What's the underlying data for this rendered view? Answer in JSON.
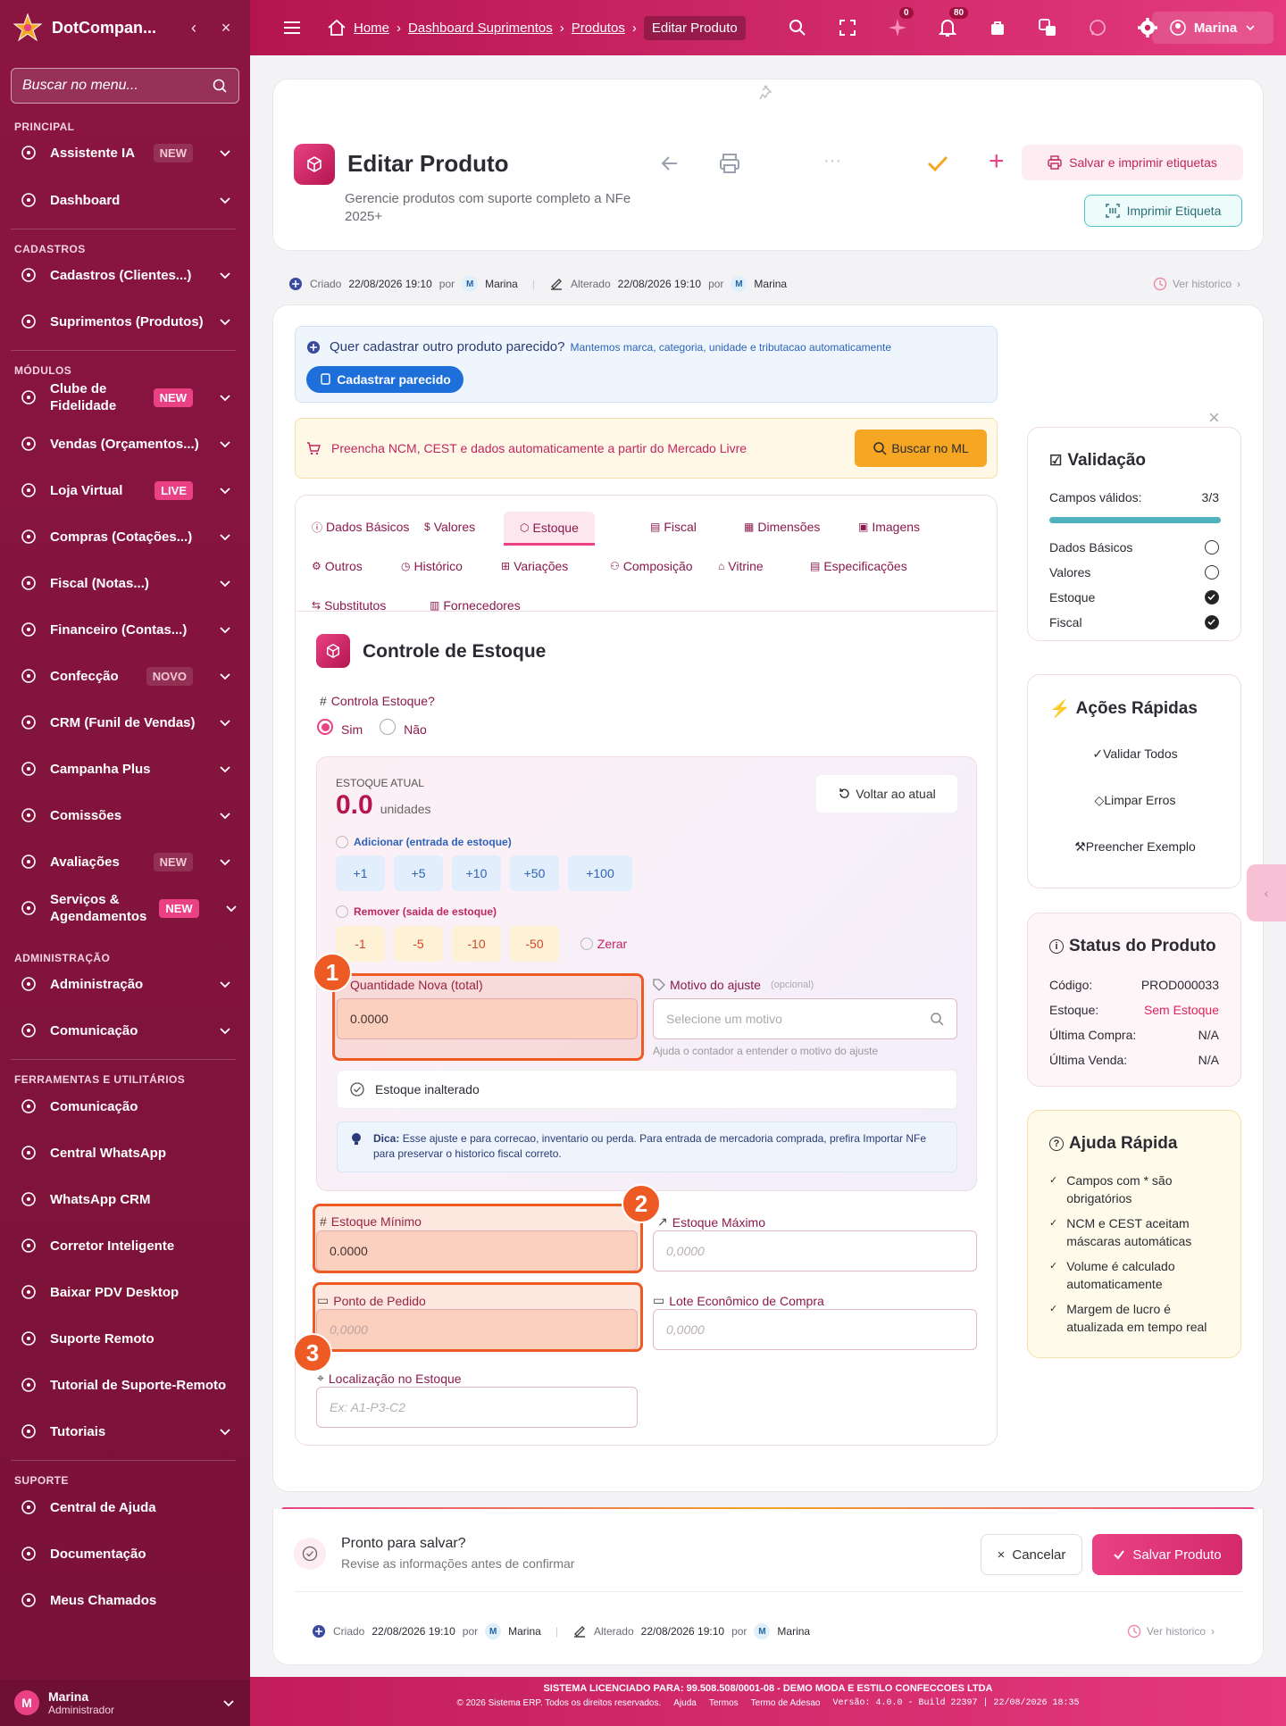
{
  "sidebar": {
    "brand": "DotCompan...",
    "search_placeholder": "Buscar no menu...",
    "sections": {
      "principal": "PRINCIPAL",
      "cadastros": "CADASTROS",
      "modulos": "MÓDULOS",
      "admin": "ADMINISTRAÇÃO",
      "tools": "FERRAMENTAS E UTILITÁRIOS",
      "suporte": "SUPORTE"
    },
    "items": [
      {
        "label": "Assistente IA",
        "badge": "NEW",
        "icon": "sparkle-icon"
      },
      {
        "label": "Dashboard",
        "icon": "dashboard-icon"
      },
      {
        "label": "Cadastros (Clientes...)",
        "icon": "users-icon"
      },
      {
        "label": "Suprimentos (Produtos)",
        "icon": "box-icon"
      },
      {
        "label": "Clube de Fidelidade",
        "badge": "NEW",
        "icon": "medal-icon"
      },
      {
        "label": "Vendas (Orçamentos...)",
        "icon": "cart-icon"
      },
      {
        "label": "Loja Virtual",
        "badge": "LIVE",
        "icon": "store-icon"
      },
      {
        "label": "Compras (Cotações...)",
        "icon": "basket-icon"
      },
      {
        "label": "Fiscal (Notas...)",
        "icon": "receipt-icon"
      },
      {
        "label": "Financeiro (Contas...)",
        "icon": "wallet-icon"
      },
      {
        "label": "Confecção",
        "badge": "NOVO",
        "icon": "grid-icon"
      },
      {
        "label": "CRM (Funil de Vendas)",
        "icon": "users-icon"
      },
      {
        "label": "Campanha Plus",
        "icon": "megaphone-icon"
      },
      {
        "label": "Comissões",
        "icon": "percent-icon"
      },
      {
        "label": "Avaliações",
        "badge": "NEW",
        "icon": "star-icon"
      },
      {
        "label": "Serviços & Agendamentos",
        "badge": "NEW",
        "icon": "calendar-icon"
      },
      {
        "label": "Administração",
        "icon": "gear-icon"
      },
      {
        "label": "Comunicação",
        "icon": "chat-icon"
      },
      {
        "label": "Comunicação",
        "icon": "broadcast-icon"
      },
      {
        "label": "Central WhatsApp",
        "icon": "whatsapp-icon"
      },
      {
        "label": "WhatsApp CRM",
        "icon": "whatsapp-icon"
      },
      {
        "label": "Corretor Inteligente",
        "icon": "wand-icon"
      },
      {
        "label": "Baixar PDV Desktop",
        "icon": "download-icon"
      },
      {
        "label": "Suporte Remoto",
        "icon": "monitor-icon"
      },
      {
        "label": "Tutorial de Suporte-Remoto",
        "icon": "graduation-icon"
      },
      {
        "label": "Tutoriais",
        "icon": "graduation-icon"
      },
      {
        "label": "Central de Ajuda",
        "icon": "help-icon"
      },
      {
        "label": "Documentação",
        "icon": "book-icon"
      },
      {
        "label": "Meus Chamados",
        "icon": "headset-icon"
      }
    ],
    "user": {
      "name": "Marina",
      "role": "Administrador"
    }
  },
  "topbar": {
    "breadcrumb": [
      "Home",
      "Dashboard Suprimentos",
      "Produtos"
    ],
    "current": "Editar Produto",
    "badges": {
      "ai": "0",
      "bell": "80"
    },
    "user": "Marina"
  },
  "header": {
    "title": "Editar Produto",
    "subtitle": "Gerencie produtos com suporte completo a NFe 2025+",
    "save_print": "Salvar e imprimir etiquetas",
    "print_label": "Imprimir Etiqueta"
  },
  "meta": {
    "created_label": "Criado",
    "created": "22/08/2026 19:10",
    "by": "por",
    "user": "Marina",
    "user_initial": "M",
    "changed_label": "Alterado",
    "changed": "22/08/2026 19:10",
    "history": "Ver historico"
  },
  "similar": {
    "question": "Quer cadastrar outro produto parecido?",
    "hint": "Mantemos marca, categoria, unidade e tributacao automaticamente",
    "button": "Cadastrar parecido"
  },
  "ml": {
    "text": "Preencha NCM, CEST e dados automaticamente a partir do Mercado Livre",
    "button": "Buscar no ML"
  },
  "tabs": [
    "Dados Básicos",
    "Valores",
    "Estoque",
    "Fiscal",
    "Dimensões",
    "Imagens",
    "Outros",
    "Histórico",
    "Variações",
    "Composição",
    "Vitrine",
    "Especificações",
    "Substitutos",
    "Fornecedores"
  ],
  "stock": {
    "title": "Controle de Estoque",
    "controls_label": "Controla Estoque?",
    "yes": "Sim",
    "no": "Não",
    "current_label": "ESTOQUE ATUAL",
    "current_value": "0.0",
    "units": "unidades",
    "back_btn": "Voltar ao atual",
    "add_label": "Adicionar (entrada de estoque)",
    "add": [
      "+1",
      "+5",
      "+10",
      "+50",
      "+100"
    ],
    "remove_label": "Remover (saida de estoque)",
    "remove": [
      "-1",
      "-5",
      "-10",
      "-50"
    ],
    "zero": "Zerar",
    "new_qty_label": "Quantidade Nova (total)",
    "new_qty_value": "0.0000",
    "reason_label": "Motivo do ajuste",
    "reason_optional": "(opcional)",
    "reason_placeholder": "Selecione um motivo",
    "reason_help": "Ajuda o contador a entender o motivo do ajuste",
    "unchanged": "Estoque inalterado",
    "tip_label": "Dica:",
    "tip": "Esse ajuste e para correcao, inventario ou perda. Para entrada de mercadoria comprada, prefira Importar NFe para preservar o historico fiscal correto.",
    "min_label": "Estoque Mínimo",
    "min_value": "0.0000",
    "max_label": "Estoque Máximo",
    "max_placeholder": "0,0000",
    "reorder_label": "Ponto de Pedido",
    "reorder_placeholder": "0,0000",
    "lot_label": "Lote Econômico de Compra",
    "lot_placeholder": "0,0000",
    "location_label": "Localização no Estoque",
    "location_placeholder": "Ex: A1-P3-C2"
  },
  "annotations": [
    "1",
    "2",
    "3"
  ],
  "validation": {
    "title": "Validação",
    "valid_label": "Campos válidos:",
    "valid_value": "3/3",
    "progress": 1.0,
    "items": [
      {
        "label": "Dados Básicos",
        "ok": false
      },
      {
        "label": "Valores",
        "ok": false
      },
      {
        "label": "Estoque",
        "ok": true
      },
      {
        "label": "Fiscal",
        "ok": true
      }
    ]
  },
  "quick_actions": {
    "title": "Ações Rápidas",
    "items": [
      "Validar Todos",
      "Limpar Erros",
      "Preencher Exemplo"
    ]
  },
  "status": {
    "title": "Status do Produto",
    "rows": [
      {
        "k": "Código:",
        "v": "PROD000033"
      },
      {
        "k": "Estoque:",
        "v": "Sem Estoque"
      },
      {
        "k": "Última Compra:",
        "v": "N/A"
      },
      {
        "k": "Última Venda:",
        "v": "N/A"
      }
    ]
  },
  "help": {
    "title": "Ajuda Rápida",
    "items": [
      "Campos com * são obrigatórios",
      "NCM e CEST aceitam máscaras automáticas",
      "Volume é calculado automaticamente",
      "Margem de lucro é atualizada em tempo real"
    ]
  },
  "save_bar": {
    "title": "Pronto para salvar?",
    "subtitle": "Revise as informações antes de confirmar",
    "cancel": "Cancelar",
    "save": "Salvar Produto"
  },
  "footer": {
    "license": "SISTEMA LICENCIADO PARA: 99.508.508/0001-08 - DEMO MODA E ESTILO CONFECCOES LTDA",
    "copy": "© 2026 Sistema ERP. Todos os direitos reservados.",
    "links": [
      "Ajuda",
      "Termos",
      "Termo de Adesao"
    ],
    "version": "Versão: 4.0.0 - Build 22397 | 22/08/2026 18:35"
  },
  "colors": {
    "brand": "#b5154f",
    "accent": "#e94184",
    "orange": "#ee5a24",
    "ml": "#f5a623"
  }
}
